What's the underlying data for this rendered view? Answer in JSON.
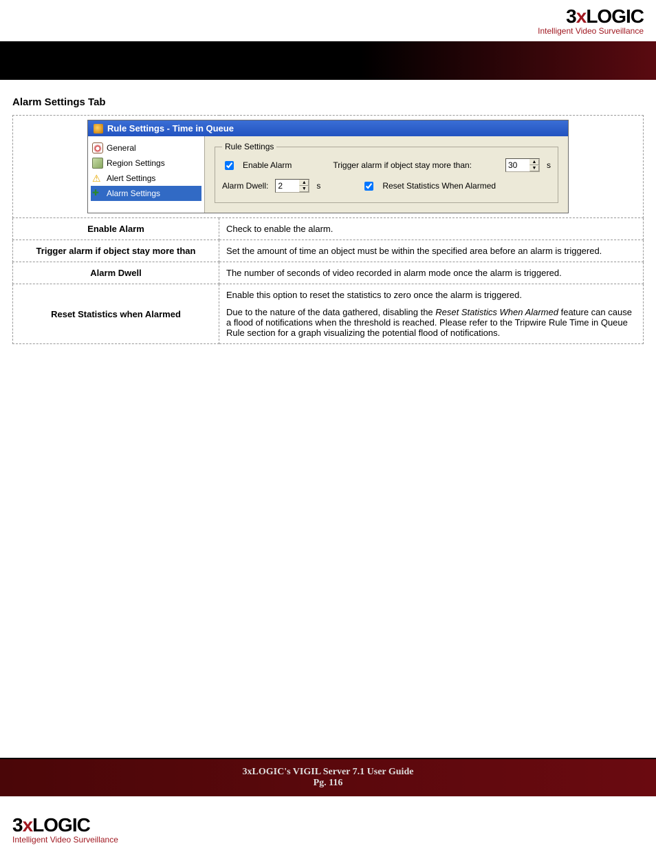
{
  "brand": {
    "logo_parts": {
      "pre": "3",
      "x": "x",
      "post": "LOGIC"
    },
    "tagline": "Intelligent Video Surveillance"
  },
  "section_title": "Alarm Settings Tab",
  "dialog": {
    "title": "Rule Settings - Time in Queue",
    "tree": {
      "general": "General",
      "region": "Region Settings",
      "alert": "Alert Settings",
      "alarm": "Alarm Settings"
    },
    "group_legend": "Rule Settings",
    "enable_alarm_label": "Enable Alarm",
    "enable_alarm_checked": true,
    "trigger_label": "Trigger alarm if object stay more than:",
    "trigger_value": "30",
    "trigger_unit": "s",
    "dwell_label": "Alarm Dwell:",
    "dwell_value": "2",
    "dwell_unit": "s",
    "reset_label": "Reset Statistics When Alarmed",
    "reset_checked": true
  },
  "rows": {
    "enable_alarm": {
      "label": "Enable Alarm",
      "desc": "Check to enable the alarm."
    },
    "trigger": {
      "label": "Trigger alarm if object stay more than",
      "desc": "Set the amount of time an object must be within the specified area before an alarm is triggered."
    },
    "dwell": {
      "label": "Alarm Dwell",
      "desc": "The number of seconds of video recorded in alarm mode once the alarm is triggered."
    },
    "reset": {
      "label": "Reset Statistics when Alarmed",
      "p1": "Enable this option to reset the statistics to zero once the alarm is triggered.",
      "p2_pre": "Due to the nature of the data gathered, disabling the ",
      "p2_em": "Reset Statistics When Alarmed",
      "p2_post": " feature can cause a flood of notifications when the threshold is reached.  Please refer to the Tripwire Rule Time in Queue Rule section for a graph visualizing the potential flood of notifications."
    }
  },
  "footer": {
    "line1": "3xLOGIC's VIGIL Server 7.1 User Guide",
    "line2": "Pg. 116"
  }
}
